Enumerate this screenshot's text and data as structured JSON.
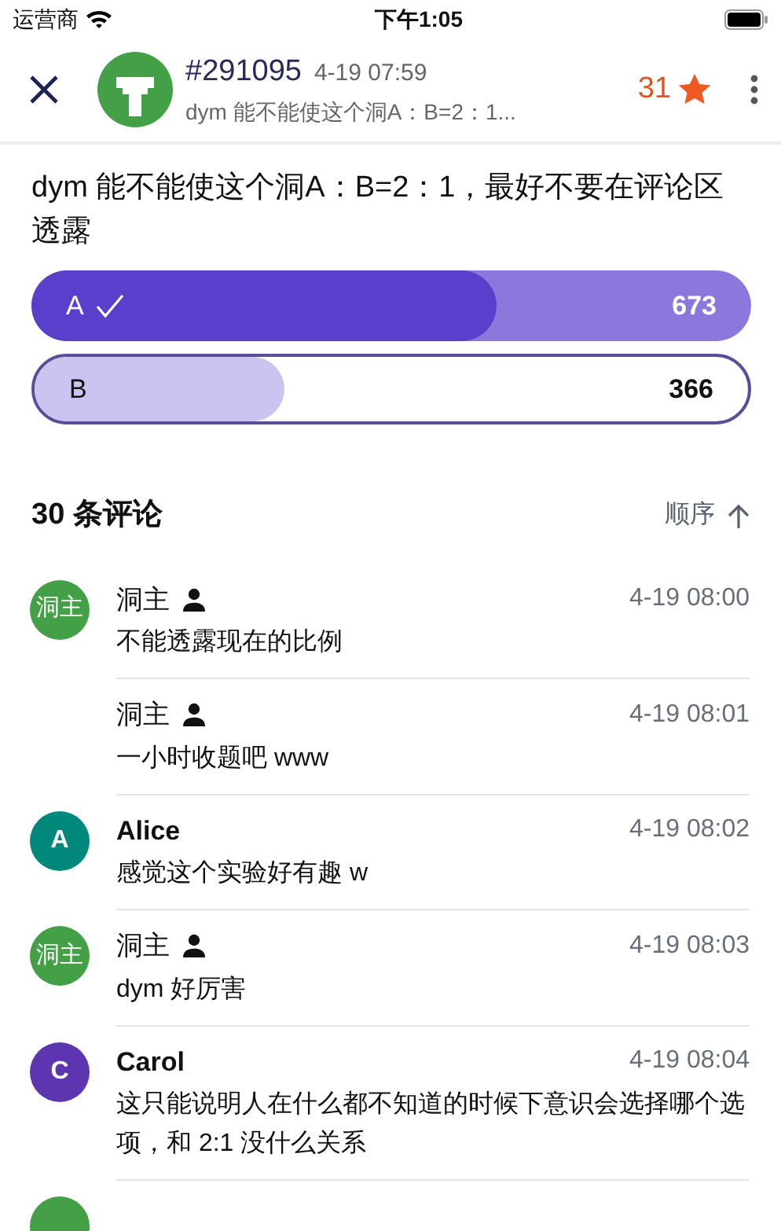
{
  "status_bar": {
    "carrier": "运营商",
    "time": "下午1:05"
  },
  "header": {
    "post_id": "#291095",
    "time": "4-19 07:59",
    "subtitle": "dym 能不能使这个洞A：B=2：1...",
    "stars": "31"
  },
  "question": "dym 能不能使这个洞A：B=2：1，最好不要在评论区透露",
  "poll": [
    {
      "label": "A",
      "count": "673",
      "selected": true,
      "level": 0.646
    },
    {
      "label": "B",
      "count": "366",
      "selected": false,
      "level": 0.35
    }
  ],
  "comments_header": {
    "title": "30 条评论",
    "sort": "顺序"
  },
  "comments": [
    {
      "kind": "op",
      "show_avatar": true,
      "avatar_text": "洞主",
      "color": "#43a047",
      "name": "洞主",
      "time": "4-19 08:00",
      "text": "不能透露现在的比例"
    },
    {
      "kind": "op",
      "show_avatar": false,
      "name": "洞主",
      "time": "4-19 08:01",
      "text": "一小时收题吧 www"
    },
    {
      "kind": "user",
      "show_avatar": true,
      "avatar_text": "A",
      "color": "#00897b",
      "name": "Alice",
      "time": "4-19 08:02",
      "text": "感觉这个实验好有趣 w"
    },
    {
      "kind": "op",
      "show_avatar": true,
      "avatar_text": "洞主",
      "color": "#43a047",
      "name": "洞主",
      "time": "4-19 08:03",
      "text": "dym 好厉害"
    },
    {
      "kind": "user",
      "show_avatar": true,
      "avatar_text": "C",
      "color": "#5e35b1",
      "name": "Carol",
      "time": "4-19 08:04",
      "text": "这只能说明人在什么都不知道的时候下意识会选择哪个选项，和 2:1 没什么关系"
    },
    {
      "kind": "cut",
      "show_avatar": true,
      "color": "#43a047"
    }
  ]
}
